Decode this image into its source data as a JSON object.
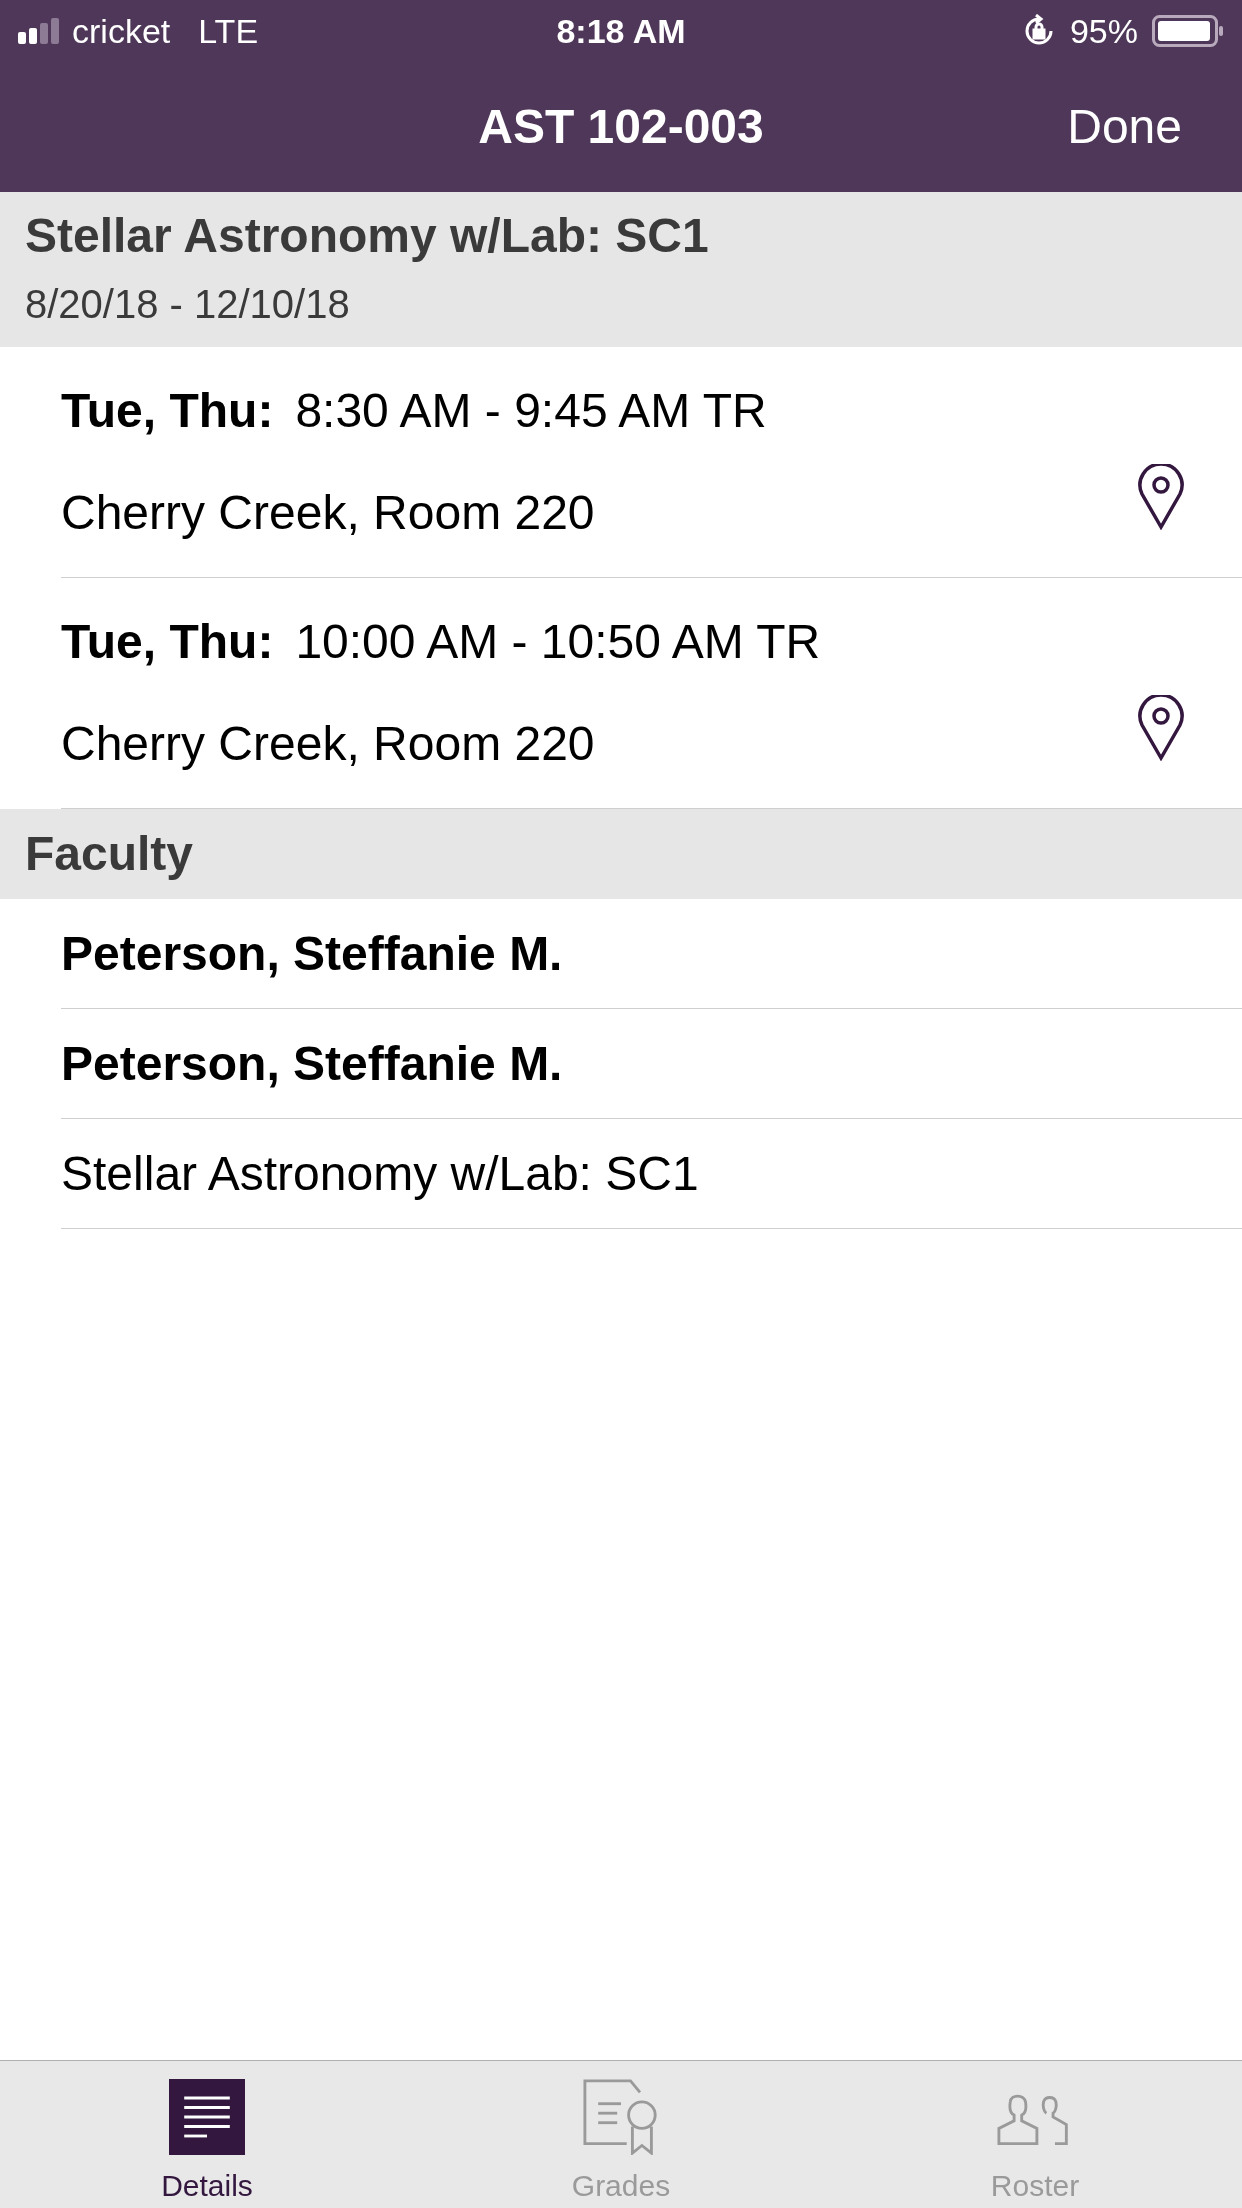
{
  "status_bar": {
    "carrier": "cricket",
    "network": "LTE",
    "time": "8:18 AM",
    "battery": "95%"
  },
  "nav": {
    "title": "AST 102-003",
    "done": "Done"
  },
  "course": {
    "title": "Stellar Astronomy w/Lab: SC1",
    "dates": "8/20/18 - 12/10/18"
  },
  "meetings": [
    {
      "days": "Tue, Thu:",
      "time": "8:30 AM - 9:45 AM TR",
      "location": "Cherry Creek, Room 220"
    },
    {
      "days": "Tue, Thu:",
      "time": "10:00 AM - 10:50 AM TR",
      "location": "Cherry Creek, Room 220"
    }
  ],
  "faculty": {
    "heading": "Faculty",
    "rows": [
      {
        "text": "Peterson, Steffanie M.",
        "kind": "name"
      },
      {
        "text": "Peterson, Steffanie M.",
        "kind": "name"
      },
      {
        "text": "Stellar Astronomy w/Lab: SC1",
        "kind": "course"
      }
    ]
  },
  "tabs": [
    {
      "label": "Details",
      "kind": "details",
      "selected": true
    },
    {
      "label": "Grades",
      "kind": "grades",
      "selected": false
    },
    {
      "label": "Roster",
      "kind": "roster",
      "selected": false
    }
  ]
}
